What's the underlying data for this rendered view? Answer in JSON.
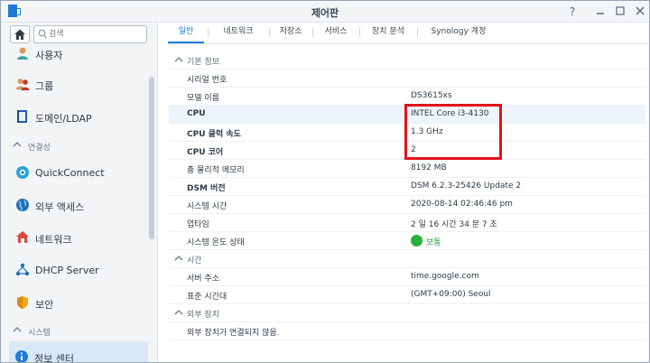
{
  "window": {
    "title": "제어판"
  },
  "sidebar": {
    "search_placeholder": "검색",
    "items": [
      {
        "id": "users",
        "label": "사용자",
        "icon": "user-icon"
      },
      {
        "id": "groups",
        "label": "그룹",
        "icon": "group-icon"
      },
      {
        "id": "domain",
        "label": "도메인/LDAP",
        "icon": "domain-icon"
      },
      {
        "id": "quickconnect",
        "label": "QuickConnect",
        "icon": "quickconnect-icon"
      },
      {
        "id": "external",
        "label": "외부 액세스",
        "icon": "globe-icon"
      },
      {
        "id": "network",
        "label": "네트워크",
        "icon": "network-icon"
      },
      {
        "id": "dhcp",
        "label": "DHCP Server",
        "icon": "dhcp-icon"
      },
      {
        "id": "security",
        "label": "보안",
        "icon": "shield-icon"
      },
      {
        "id": "info",
        "label": "정보 센터",
        "icon": "info-icon",
        "active": true
      }
    ],
    "sections": {
      "connectivity": "연결성",
      "system": "시스템"
    }
  },
  "tabs": [
    "일반",
    "네트워크",
    "저장소",
    "서비스",
    "장치 분석",
    "Synology 계정"
  ],
  "active_tab": "일반",
  "general": {
    "basic_info_label": "기본 정보",
    "rows": [
      {
        "key": "시리얼 번호",
        "value": ""
      },
      {
        "key": "모델 이름",
        "value": "DS3615xs"
      },
      {
        "key": "CPU",
        "value": "INTEL Core i3-4130"
      },
      {
        "key": "CPU 클럭 속도",
        "value": "1.3 GHz"
      },
      {
        "key": "CPU 코어",
        "value": "2"
      },
      {
        "key": "총 물리적 메모리",
        "value": "8192 MB"
      },
      {
        "key": "DSM 버전",
        "value": "DSM 6.2.3-25426 Update 2"
      },
      {
        "key": "시스템 시간",
        "value": "2020-08-14 02:46:46 pm"
      },
      {
        "key": "업타임",
        "value": "2 일 16 시간 34 분 7 초"
      },
      {
        "key": "시스템 온도 상태",
        "value": "보통"
      }
    ],
    "time_label": "시간",
    "time_rows": [
      {
        "key": "서버 주소",
        "value": "time.google.com"
      },
      {
        "key": "표준 시간대",
        "value": "(GMT+09:00) Seoul"
      }
    ],
    "external_devices_label": "외부 장치",
    "external_note": "외부 장치가 연결되지 않음."
  },
  "colors": {
    "accent": "#1d7cd6",
    "highlight": "#e1121a",
    "status_ok": "#27b33a"
  }
}
